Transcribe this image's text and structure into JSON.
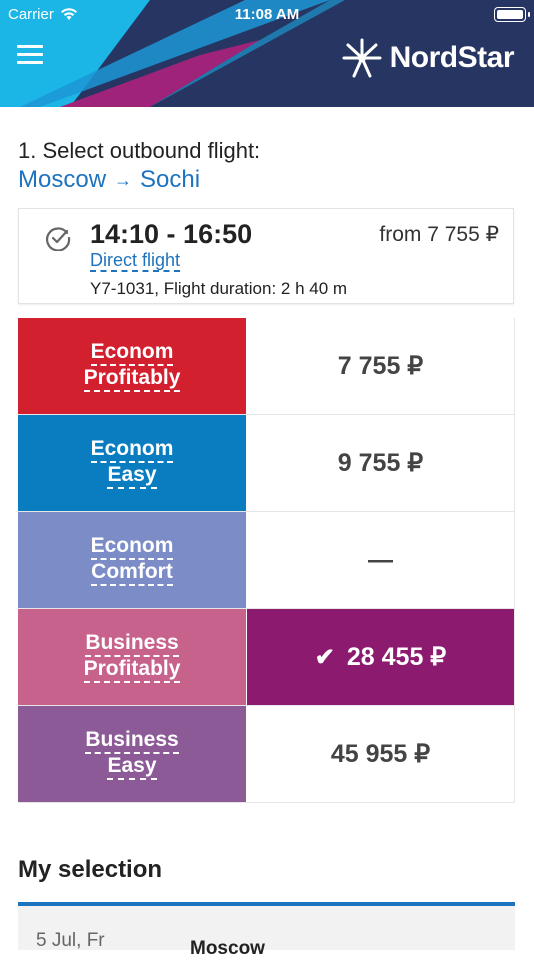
{
  "status_bar": {
    "carrier": "Carrier",
    "time": "11:08 AM"
  },
  "header": {
    "logo_text": "NordStar",
    "menu_icon": "hamburger-menu-icon",
    "colors": {
      "cyan": "#1bb5e6",
      "navy": "#263561",
      "magenta": "#a0237a",
      "blue": "#1e73be"
    }
  },
  "step": {
    "title": "1. Select outbound flight:",
    "origin": "Moscow",
    "destination": "Sochi",
    "arrow": "→"
  },
  "flight": {
    "times": "14:10 - 16:50",
    "type": "Direct flight",
    "from_price": "from 7 755 ₽",
    "info": "Y7-1031, Flight duration: 2 h 40 m"
  },
  "fares": [
    {
      "line1": "Econom",
      "line2": "Profitably",
      "price": "7 755 ₽",
      "color": "#d2202f",
      "selected": false
    },
    {
      "line1": "Econom",
      "line2": "Easy",
      "price": "9 755 ₽",
      "color": "#0a7dc1",
      "selected": false
    },
    {
      "line1": "Econom",
      "line2": "Comfort",
      "price": "—",
      "color": "#7b8cc6",
      "selected": false
    },
    {
      "line1": "Business",
      "line2": "Profitably",
      "price": "28 455 ₽",
      "color": "#c7628d",
      "selected": true,
      "selected_color": "#8c1a6f"
    },
    {
      "line1": "Business",
      "line2": "Easy",
      "price": "45 955 ₽",
      "color": "#8c5a96",
      "selected": false
    }
  ],
  "my_selection": {
    "title": "My selection",
    "date": "5 Jul, Fr",
    "city": "Moscow"
  }
}
